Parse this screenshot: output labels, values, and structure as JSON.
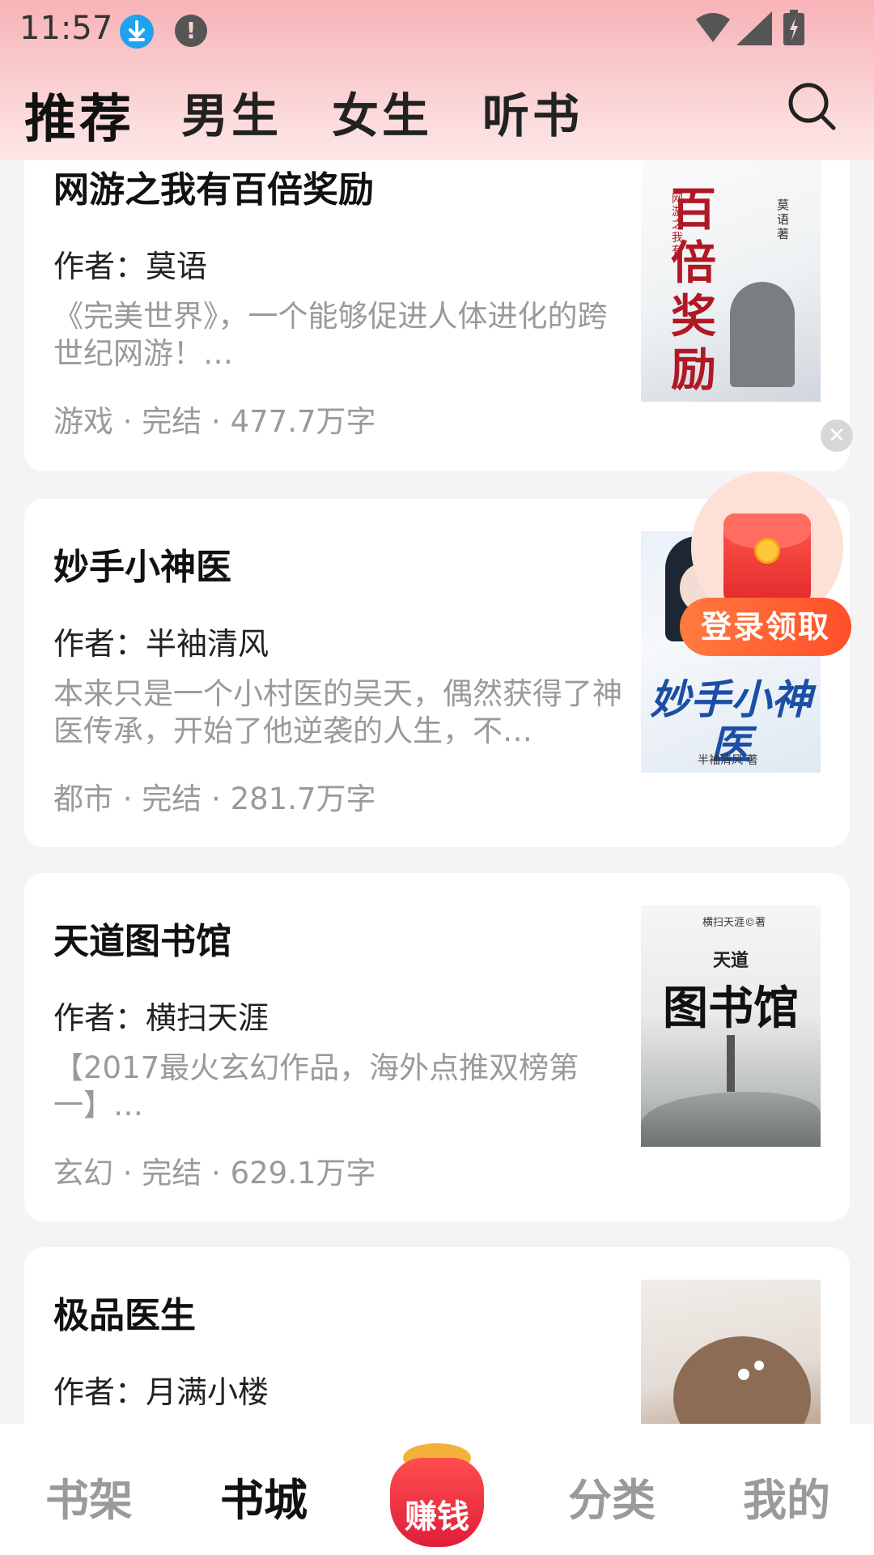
{
  "status_bar": {
    "time": "11:57"
  },
  "tabs": [
    {
      "label": "推荐",
      "active": true
    },
    {
      "label": "男生",
      "active": false
    },
    {
      "label": "女生",
      "active": false
    },
    {
      "label": "听书",
      "active": false
    }
  ],
  "search": {
    "icon": "search-icon"
  },
  "books": [
    {
      "title": "网游之我有百倍奖励",
      "author": "作者：莫语",
      "desc": "《完美世界》，一个能够促进人体进化的跨世纪网游！…",
      "meta": "游戏 · 完结 · 477.7万字",
      "cover": {
        "big": "百倍奖励",
        "small_left": "网游之我有",
        "small_right": "莫语 著"
      }
    },
    {
      "title": "妙手小神医",
      "author": "作者：半袖清风",
      "desc": "本来只是一个小村医的吴天，偶然获得了神医传承，开始了他逆袭的人生，不…",
      "meta": "都市 · 完结 · 281.7万字",
      "cover": {
        "big": "妙手小神医",
        "small": "半袖清风 著"
      }
    },
    {
      "title": "天道图书馆",
      "author": "作者：横扫天涯",
      "desc": "【2017最火玄幻作品，海外点推双榜第一】…",
      "meta": "玄幻 · 完结 · 629.1万字",
      "cover": {
        "big": "图书馆",
        "top": "天道",
        "small": "横扫天涯©著"
      }
    },
    {
      "title": "极品医生",
      "author": "作者：月满小楼",
      "desc": "",
      "meta": "",
      "cover": {}
    }
  ],
  "promo": {
    "button_label": "登录领取"
  },
  "bottom_nav": [
    {
      "label": "书架",
      "active": false
    },
    {
      "label": "书城",
      "active": true
    },
    {
      "label": "赚钱",
      "active": false
    },
    {
      "label": "分类",
      "active": false
    },
    {
      "label": "我的",
      "active": false
    }
  ]
}
